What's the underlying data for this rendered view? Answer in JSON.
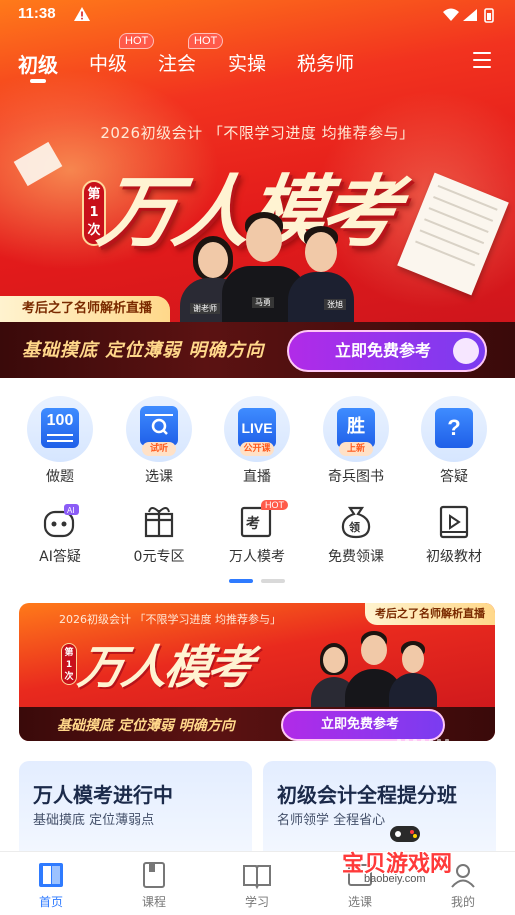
{
  "status_bar": {
    "time": "11:38"
  },
  "top_tabs": [
    {
      "label": "初级",
      "active": true,
      "hot": ""
    },
    {
      "label": "中级",
      "active": false,
      "hot": "HOT"
    },
    {
      "label": "注会",
      "active": false,
      "hot": "HOT"
    },
    {
      "label": "实操",
      "active": false,
      "hot": ""
    },
    {
      "label": "税务师",
      "active": false,
      "hot": ""
    }
  ],
  "hero_banner": {
    "subtitle": "2026初级会计 「不限学习进度 均推荐参与」",
    "badge": "第1次",
    "title": "万人模考",
    "ribbon": "考后之了名师解析直播",
    "slogan": "基础摸底 定位薄弱 明确方向",
    "cta": "立即免费参考",
    "teachers": [
      "谢老师",
      "马勇",
      "张旭"
    ]
  },
  "quick_grid_row1": [
    {
      "label": "做题",
      "icon": "100-paper-icon",
      "icon_text": "100",
      "tag": ""
    },
    {
      "label": "选课",
      "icon": "search-course-icon",
      "icon_text": "",
      "tag": "试听"
    },
    {
      "label": "直播",
      "icon": "live-tv-icon",
      "icon_text": "LIVE",
      "tag": "公开课"
    },
    {
      "label": "奇兵图书",
      "icon": "book-icon",
      "icon_text": "胜",
      "tag": "上新"
    },
    {
      "label": "答疑",
      "icon": "question-icon",
      "icon_text": "?",
      "tag": ""
    }
  ],
  "quick_grid_row2": [
    {
      "label": "AI答疑",
      "icon": "ai-robot-icon",
      "hot": ""
    },
    {
      "label": "0元专区",
      "icon": "gift-box-icon",
      "hot": ""
    },
    {
      "label": "万人模考",
      "icon": "exam-icon",
      "hot": "HOT"
    },
    {
      "label": "免费领课",
      "icon": "money-bag-icon",
      "hot": ""
    },
    {
      "label": "初级教材",
      "icon": "video-book-icon",
      "hot": ""
    }
  ],
  "banner2": {
    "subtitle": "2026初级会计 「不限学习进度 均推荐参与」",
    "badge": "第1次",
    "title": "万人模考",
    "ribbon": "考后之了名师解析直播",
    "slogan": "基础摸底 定位薄弱 明确方向",
    "cta": "立即免费参考"
  },
  "cards": [
    {
      "title": "万人模考进行中",
      "subtitle": "基础摸底 定位薄弱点"
    },
    {
      "title": "初级会计全程提分班",
      "subtitle": "名师领学 全程省心"
    }
  ],
  "bottom_nav": [
    {
      "label": "首页",
      "icon": "home-icon",
      "active": true
    },
    {
      "label": "课程",
      "icon": "course-icon",
      "active": false
    },
    {
      "label": "学习",
      "icon": "study-book-icon",
      "active": false
    },
    {
      "label": "选课",
      "icon": "select-course-icon",
      "active": false
    },
    {
      "label": "我的",
      "icon": "profile-icon",
      "active": false
    }
  ],
  "watermark": {
    "text": "宝贝游戏网",
    "url": "baobeiy.com"
  },
  "colors": {
    "brand_red": "#e31b1b",
    "accent_blue": "#2f7bff",
    "cta_purple": "#9a34ec",
    "gold": "#ffd78a"
  }
}
